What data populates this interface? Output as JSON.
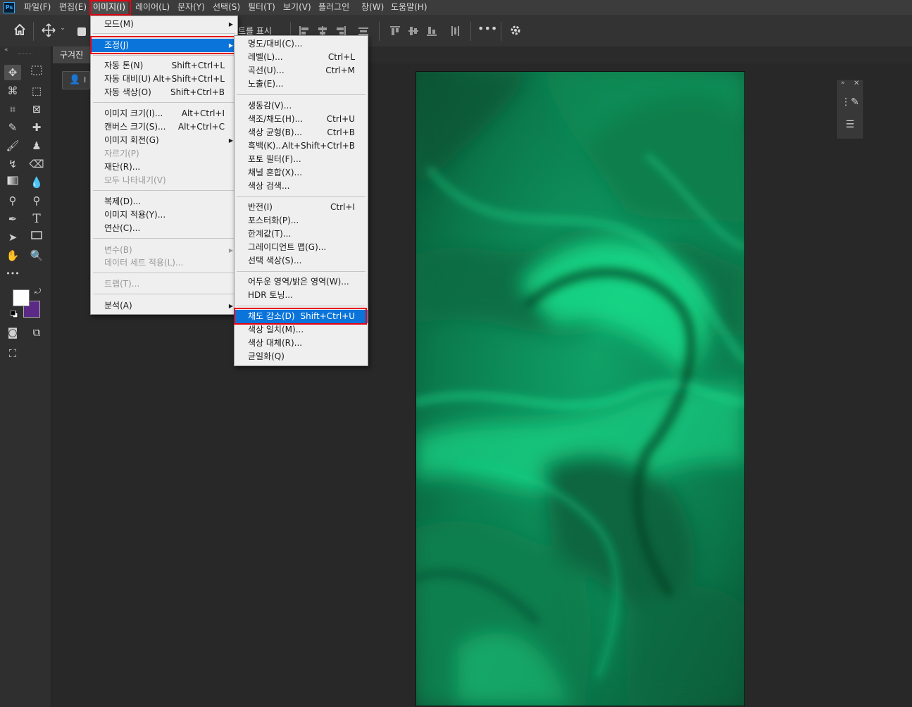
{
  "app": {
    "logo_text": "Ps"
  },
  "menubar": {
    "items": [
      "파일(F)",
      "편집(E)",
      "이미지(I)",
      "레이어(L)",
      "문자(Y)",
      "선택(S)",
      "필터(T)",
      "보기(V)",
      "플러그인",
      "창(W)",
      "도움말(H)"
    ],
    "active": "이미지(I)"
  },
  "options_bar": {
    "partial_label": "트를 표시"
  },
  "document": {
    "tab_label": "구겨진",
    "layer_button_partial": "I"
  },
  "image_menu": {
    "items": [
      {
        "label": "모드(M)",
        "shortcut": "",
        "submenu": true
      },
      {
        "label": "조정(J)",
        "shortcut": "",
        "submenu": true,
        "highlighted": true
      },
      {
        "label": "자동 톤(N)",
        "shortcut": "Shift+Ctrl+L"
      },
      {
        "label": "자동 대비(U)",
        "shortcut": "Alt+Shift+Ctrl+L"
      },
      {
        "label": "자동 색상(O)",
        "shortcut": "Shift+Ctrl+B"
      },
      {
        "label": "이미지 크기(I)...",
        "shortcut": "Alt+Ctrl+I"
      },
      {
        "label": "캔버스 크기(S)...",
        "shortcut": "Alt+Ctrl+C"
      },
      {
        "label": "이미지 회전(G)",
        "shortcut": "",
        "submenu": true
      },
      {
        "label": "자르기(P)",
        "shortcut": "",
        "disabled": true
      },
      {
        "label": "재단(R)...",
        "shortcut": ""
      },
      {
        "label": "모두 나타내기(V)",
        "shortcut": "",
        "disabled": true
      },
      {
        "label": "복제(D)...",
        "shortcut": ""
      },
      {
        "label": "이미지 적용(Y)...",
        "shortcut": ""
      },
      {
        "label": "연산(C)...",
        "shortcut": ""
      },
      {
        "label": "변수(B)",
        "shortcut": "",
        "submenu": true,
        "disabled": true
      },
      {
        "label": "데이터 세트 적용(L)...",
        "shortcut": "",
        "disabled": true
      },
      {
        "label": "트랩(T)...",
        "shortcut": "",
        "disabled": true
      },
      {
        "label": "분석(A)",
        "shortcut": "",
        "submenu": true
      }
    ]
  },
  "adjust_menu": {
    "items": [
      {
        "label": "명도/대비(C)...",
        "shortcut": ""
      },
      {
        "label": "레벨(L)...",
        "shortcut": "Ctrl+L"
      },
      {
        "label": "곡선(U)...",
        "shortcut": "Ctrl+M"
      },
      {
        "label": "노출(E)...",
        "shortcut": ""
      },
      {
        "label": "생동감(V)...",
        "shortcut": ""
      },
      {
        "label": "색조/채도(H)...",
        "shortcut": "Ctrl+U"
      },
      {
        "label": "색상 균형(B)...",
        "shortcut": "Ctrl+B"
      },
      {
        "label": "흑백(K)...",
        "shortcut": "Alt+Shift+Ctrl+B"
      },
      {
        "label": "포토 필터(F)...",
        "shortcut": ""
      },
      {
        "label": "채널 혼합(X)...",
        "shortcut": ""
      },
      {
        "label": "색상 검색...",
        "shortcut": ""
      },
      {
        "label": "반전(I)",
        "shortcut": "Ctrl+I"
      },
      {
        "label": "포스터화(P)...",
        "shortcut": ""
      },
      {
        "label": "한계값(T)...",
        "shortcut": ""
      },
      {
        "label": "그레이디언트 맵(G)...",
        "shortcut": ""
      },
      {
        "label": "선택 색상(S)...",
        "shortcut": ""
      },
      {
        "label": "어두운 영역/밝은 영역(W)...",
        "shortcut": ""
      },
      {
        "label": "HDR 토닝...",
        "shortcut": ""
      },
      {
        "label": "채도 감소(D)",
        "shortcut": "Shift+Ctrl+U",
        "highlighted": true
      },
      {
        "label": "색상 일치(M)...",
        "shortcut": ""
      },
      {
        "label": "색상 대체(R)...",
        "shortcut": ""
      },
      {
        "label": "균일화(Q)",
        "shortcut": ""
      }
    ]
  },
  "colors": {
    "foreground": "#ffffff",
    "background": "#5b2a86",
    "highlight": "#0a74da",
    "callout": "#e8000f",
    "fabric": "#0f8a55"
  }
}
